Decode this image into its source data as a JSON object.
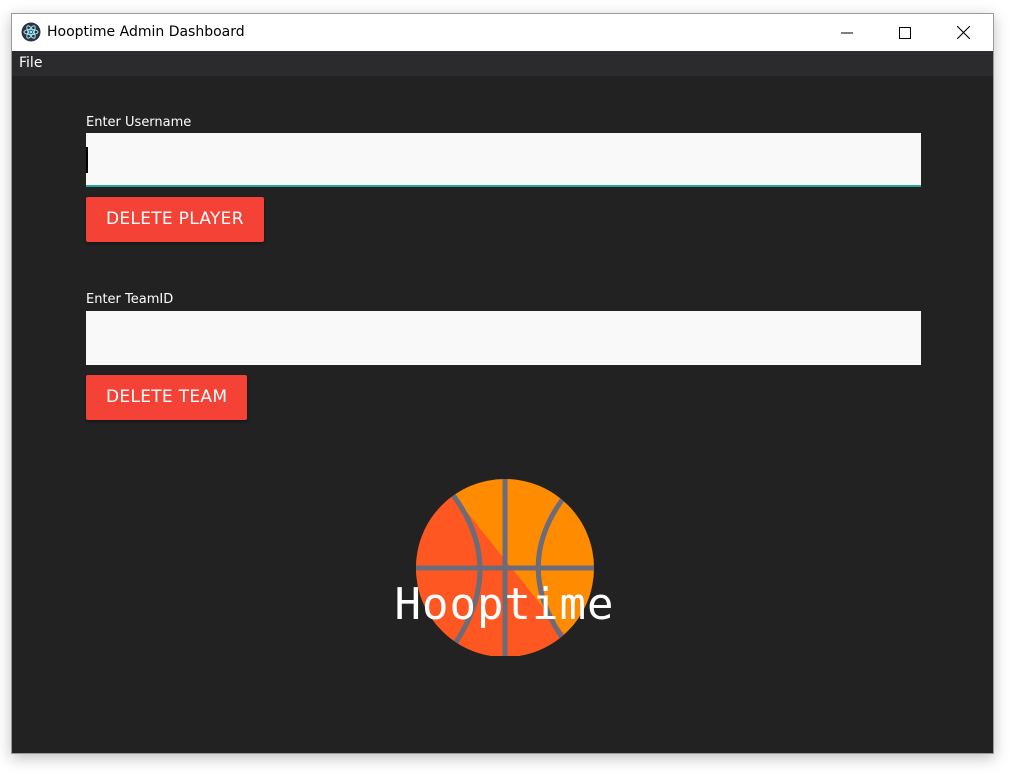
{
  "window": {
    "title": "Hooptime Admin Dashboard",
    "icon": "electron-app-icon"
  },
  "menu": {
    "items": [
      "File"
    ]
  },
  "player_section": {
    "label": "Enter Username",
    "input_value": "",
    "button_label": "DELETE PLAYER"
  },
  "team_section": {
    "label": "Enter TeamID",
    "input_value": "",
    "button_label": "DELETE TEAM"
  },
  "logo": {
    "text": "Hooptime",
    "icon": "basketball-icon"
  },
  "colors": {
    "background": "#222222",
    "menubar": "#2b2b2e",
    "danger": "#f44336",
    "input_focus": "#26a69a",
    "ball_orange": "#ff8c00",
    "ball_red": "#ff5722",
    "ball_seams": "#6b6b7a"
  }
}
